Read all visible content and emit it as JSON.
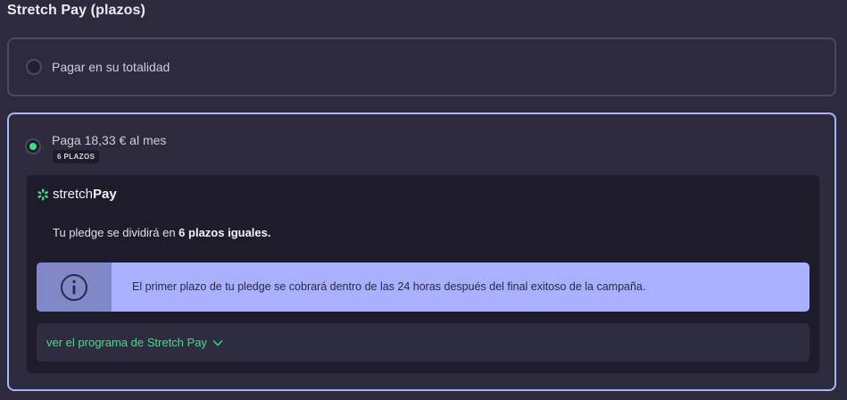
{
  "section": {
    "title": "Stretch Pay (plazos)"
  },
  "options": {
    "full": {
      "label": "Pagar en su totalidad",
      "selected": false
    },
    "installments": {
      "label": "Paga 18,33 € al mes",
      "badge": "6 PLAZOS",
      "selected": true
    }
  },
  "stretch": {
    "logo_light": "stretch",
    "logo_bold": "Pay",
    "pledge_prefix": "Tu pledge se dividirá en ",
    "pledge_bold": "6 plazos iguales.",
    "info_icon": "info-circle-icon",
    "info_text": "El primer plazo de tu pledge se cobrará dentro de las 24 horas después del final exitoso de la campaña.",
    "schedule_link": "ver el programa de Stretch Pay",
    "schedule_icon": "chevron-down-icon"
  },
  "colors": {
    "background": "#2c2a3c",
    "accent_green": "#3ddc84",
    "selected_border": "#a9b2ff",
    "info_bg": "#a9b0ff"
  }
}
